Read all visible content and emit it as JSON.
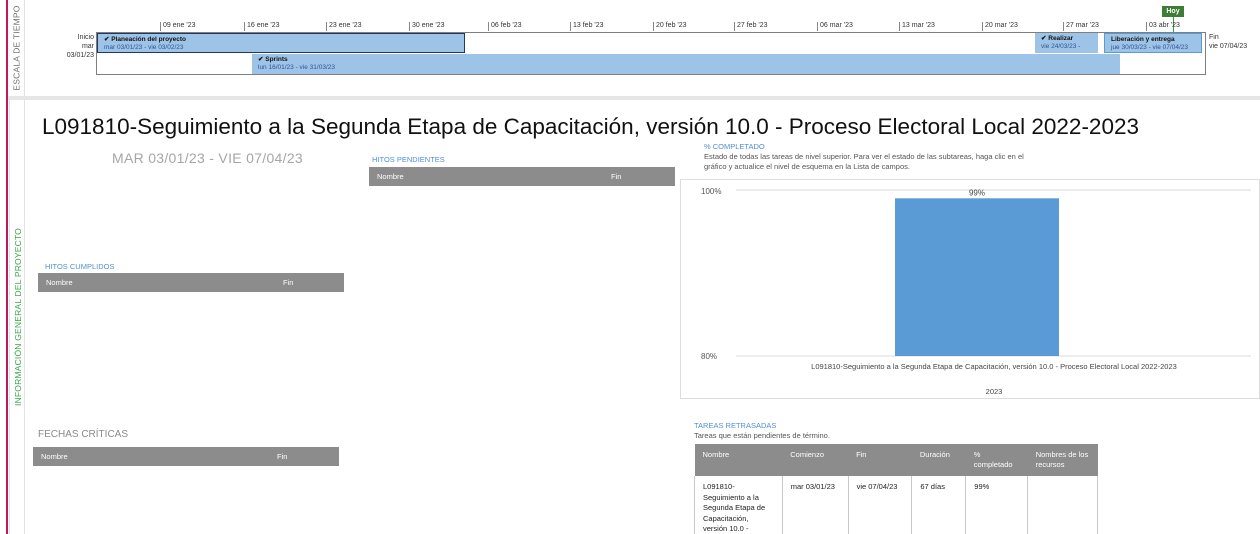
{
  "side_labels": {
    "timeline": "ESCALA DE TIEMPO",
    "overview": "INFORMACIÓN GENERAL DEL PROYECTO"
  },
  "timeline": {
    "start_label": "Inicio",
    "start_date": "mar 03/01/23",
    "end_label": "Fin",
    "end_date": "vie 07/04/23",
    "today_label": "Hoy",
    "ticks": [
      "09 ene '23",
      "16 ene '23",
      "23 ene '23",
      "30 ene '23",
      "06 feb '23",
      "13 feb '23",
      "20 feb '23",
      "27 feb '23",
      "06 mar '23",
      "13 mar '23",
      "20 mar '23",
      "27 mar '23",
      "03 abr '23"
    ],
    "bars": {
      "plan": {
        "title": "✔ Planeación del proyecto",
        "dates": "mar 03/01/23 - vie 03/02/23"
      },
      "sprints": {
        "title": "✔ Sprints",
        "dates": "lun 16/01/23 - vie 31/03/23"
      },
      "realizar": {
        "title": "✔ Realizar",
        "dates": "vie 24/03/23 -"
      },
      "liberacion": {
        "title": "Liberación y entrega",
        "dates": "jue 30/03/23 - vie 07/04/23"
      }
    }
  },
  "overview": {
    "title": "L091810-Seguimiento a la Segunda Etapa de Capacitación, versión 10.0 - Proceso Electoral Local 2022-2023",
    "dates": "MAR 03/01/23 - VIE 07/04/23",
    "hitos_pendientes": {
      "title": "HITOS PENDIENTES",
      "col_name": "Nombre",
      "col_end": "Fin"
    },
    "hitos_cumplidos": {
      "title": "HITOS CUMPLIDOS",
      "col_name": "Nombre",
      "col_end": "Fin"
    },
    "fechas_criticas": {
      "title": "FECHAS CRÍTICAS",
      "col_name": "Nombre",
      "col_end": "Fin"
    },
    "completado": {
      "title": "% COMPLETADO",
      "description_line1": "Estado de todas las tareas de nivel superior. Para ver el estado de las subtareas, haga clic en el",
      "description_line2": "gráfico y actualice el nivel de esquema en la Lista de campos."
    },
    "tareas_retrasadas": {
      "title": "TAREAS RETRASADAS",
      "subtitle": "Tareas que están pendientes de término.",
      "headers": [
        "Nombre",
        "Comienzo",
        "Fin",
        "Duración",
        "% completado",
        "Nombres de los recursos"
      ],
      "rows": [
        {
          "name": "L091810-Seguimiento a la Segunda Etapa de Capacitación, versión 10.0 -",
          "start": "mar 03/01/23",
          "end": "vie 07/04/23",
          "duration": "67 días",
          "pct": "99%",
          "resources": ""
        }
      ]
    }
  },
  "chart_data": {
    "type": "bar",
    "categories": [
      "L091810-Seguimiento a la Segunda Etapa de Capacitación, versión 10.0 - Proceso Electoral Local 2022-2023"
    ],
    "values": [
      99
    ],
    "value_labels": [
      "99%"
    ],
    "x_group_label": "2023",
    "ylim": [
      80,
      100
    ],
    "ytick_labels": [
      "100%",
      "80%"
    ],
    "bar_color": "#5b9bd5",
    "grid": false
  }
}
